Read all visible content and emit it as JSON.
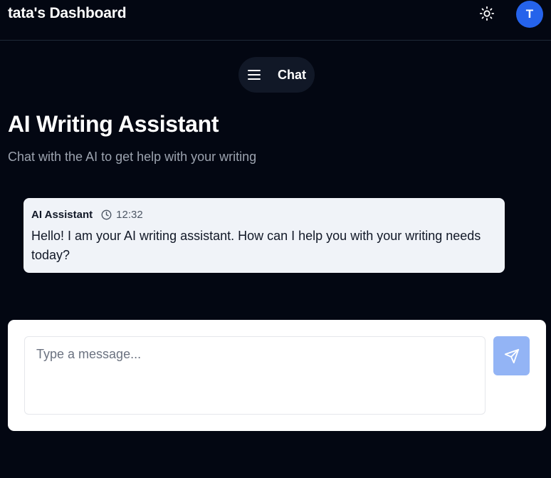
{
  "header": {
    "title": "tata's Dashboard",
    "theme_icon": "sun-icon",
    "avatar_initial": "T",
    "avatar_color": "#2563eb"
  },
  "nav": {
    "menu_icon": "menu-icon",
    "label": "Chat"
  },
  "page": {
    "title": "AI Writing Assistant",
    "subtitle": "Chat with the AI to get help with your writing"
  },
  "messages": [
    {
      "author": "AI Assistant",
      "time": "12:32",
      "time_icon": "clock-icon",
      "text": "Hello! I am your AI writing assistant. How can I help you with your writing needs today?"
    }
  ],
  "composer": {
    "placeholder": "Type a message...",
    "value": "",
    "send_icon": "send-icon",
    "send_color": "#93b4f5"
  },
  "colors": {
    "background": "#030712",
    "message_bubble": "#f0f3f8",
    "pill": "#111827"
  }
}
